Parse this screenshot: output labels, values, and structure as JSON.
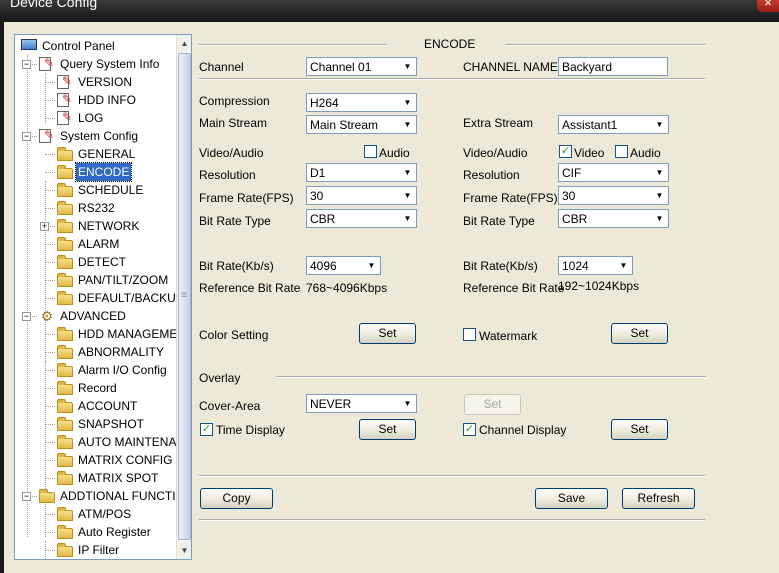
{
  "window": {
    "title": "Device Config",
    "close_icon": "×"
  },
  "tree": {
    "nodes": [
      {
        "label": "Control Panel",
        "icon": "monitor-icon"
      },
      {
        "label": "Query System Info",
        "icon": "document-icon"
      },
      {
        "label": "VERSION",
        "icon": "document-icon"
      },
      {
        "label": "HDD INFO",
        "icon": "document-icon"
      },
      {
        "label": "LOG",
        "icon": "document-icon"
      },
      {
        "label": "System Config",
        "icon": "settings-icon"
      },
      {
        "label": "GENERAL",
        "icon": "folder-icon"
      },
      {
        "label": "ENCODE",
        "icon": "folder-icon",
        "selected": true
      },
      {
        "label": "SCHEDULE",
        "icon": "folder-icon"
      },
      {
        "label": "RS232",
        "icon": "folder-icon"
      },
      {
        "label": "NETWORK",
        "icon": "folder-icon"
      },
      {
        "label": "ALARM",
        "icon": "folder-icon"
      },
      {
        "label": "DETECT",
        "icon": "folder-icon"
      },
      {
        "label": "PAN/TILT/ZOOM",
        "icon": "folder-icon"
      },
      {
        "label": "DEFAULT/BACKUP",
        "icon": "folder-icon"
      },
      {
        "label": "ADVANCED",
        "icon": "gear-icon"
      },
      {
        "label": "HDD MANAGEME",
        "icon": "folder-icon"
      },
      {
        "label": "ABNORMALITY",
        "icon": "folder-icon"
      },
      {
        "label": "Alarm I/O Config",
        "icon": "folder-icon"
      },
      {
        "label": "Record",
        "icon": "folder-icon"
      },
      {
        "label": "ACCOUNT",
        "icon": "folder-icon"
      },
      {
        "label": "SNAPSHOT",
        "icon": "folder-icon"
      },
      {
        "label": "AUTO MAINTENA",
        "icon": "folder-icon"
      },
      {
        "label": "MATRIX CONFIG",
        "icon": "folder-icon"
      },
      {
        "label": "MATRIX SPOT",
        "icon": "folder-icon"
      },
      {
        "label": "ADDTIONAL FUNCTIO",
        "icon": "folder-icon"
      },
      {
        "label": "ATM/POS",
        "icon": "folder-icon"
      },
      {
        "label": "Auto Register",
        "icon": "folder-icon"
      },
      {
        "label": "IP Filter",
        "icon": "folder-icon"
      }
    ],
    "expander_collapsed": "+",
    "expander_expanded": "−",
    "scroll_up": "▲",
    "scroll_down": "▼",
    "scroll_grip": "≡"
  },
  "encode": {
    "section_title": "ENCODE",
    "channel_label": "Channel",
    "channel_value": "Channel 01",
    "channel_name_label": "CHANNEL NAME",
    "channel_name_value": "Backyard",
    "compression_label": "Compression",
    "compression_value": "H264",
    "main_stream_label": "Main Stream",
    "main_stream_value": "Main Stream",
    "extra_stream_label": "Extra Stream",
    "extra_stream_value": "Assistant1",
    "video_audio_label": "Video/Audio",
    "audio_label": "Audio",
    "video_label": "Video",
    "left_audio_checked": false,
    "right_video_checked": true,
    "right_audio_checked": false,
    "resolution_label": "Resolution",
    "left_resolution": "D1",
    "right_resolution": "CIF",
    "frame_rate_label": "Frame Rate(FPS)",
    "left_frame_rate": "30",
    "right_frame_rate": "30",
    "bit_rate_type_label": "Bit Rate Type",
    "left_bit_rate_type": "CBR",
    "right_bit_rate_type": "CBR",
    "bit_rate_label": "Bit Rate(Kb/s)",
    "left_bit_rate": "4096",
    "right_bit_rate": "1024",
    "reference_bit_rate_label": "Reference Bit Rate",
    "left_reference": "768~4096Kbps",
    "right_reference": "192~1024Kbps",
    "color_setting_label": "Color Setting",
    "set_label": "Set",
    "watermark_label": "Watermark",
    "watermark_checked": false,
    "overlay_label": "Overlay",
    "cover_area_label": "Cover-Area",
    "cover_area_value": "NEVER",
    "time_display_label": "Time Display",
    "time_display_checked": true,
    "channel_display_label": "Channel Display",
    "channel_display_checked": true,
    "copy_label": "Copy",
    "save_label": "Save",
    "refresh_label": "Refresh",
    "dropdown_arrow": "▼",
    "check_mark": "✓"
  }
}
